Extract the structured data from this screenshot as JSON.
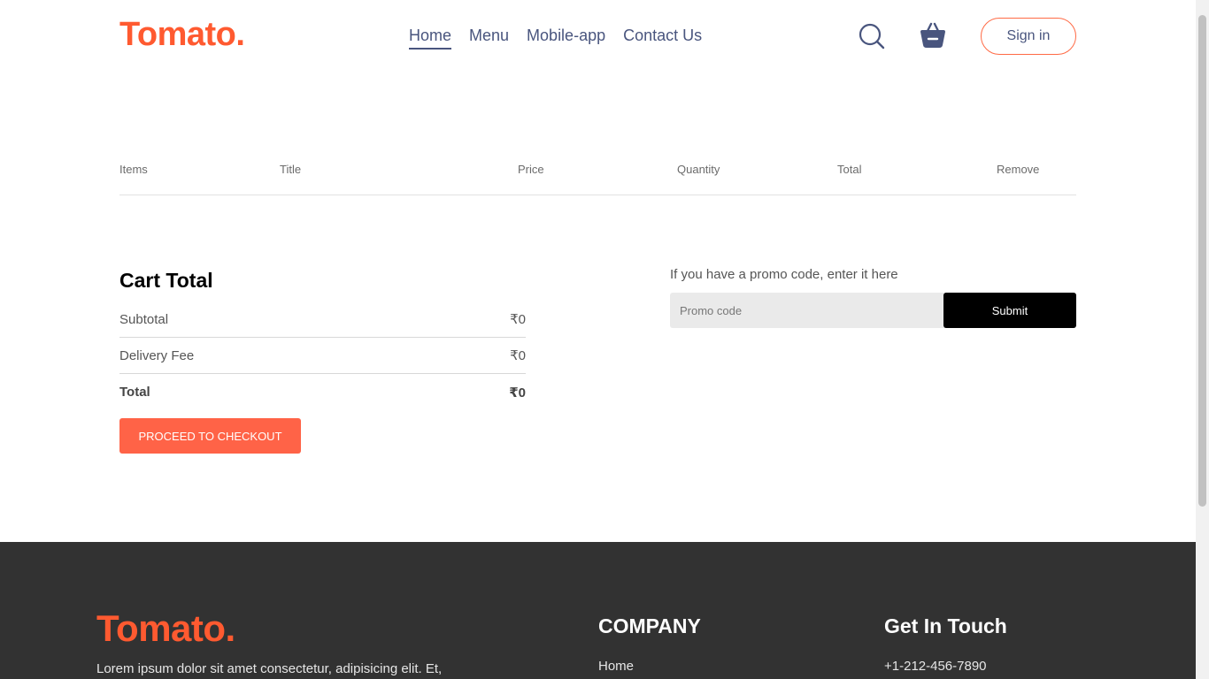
{
  "navbar": {
    "logo": "Tomato.",
    "links": [
      "Home",
      "Menu",
      "Mobile-app",
      "Contact Us"
    ],
    "active": "Home",
    "signin_label": "Sign in",
    "icons": [
      "search-icon",
      "basket-icon"
    ]
  },
  "cart": {
    "columns": [
      "Items",
      "Title",
      "Price",
      "Quantity",
      "Total",
      "Remove"
    ],
    "items": []
  },
  "cart_total": {
    "title": "Cart Total",
    "subtotal_label": "Subtotal",
    "subtotal_value": "₹0",
    "delivery_label": "Delivery Fee",
    "delivery_value": "₹0",
    "total_label": "Total",
    "total_value": "₹0",
    "checkout_label": "PROCEED TO CHECKOUT"
  },
  "promo": {
    "label": "If you have a promo code, enter it here",
    "placeholder": "Promo code",
    "value": "",
    "submit_label": "Submit"
  },
  "footer": {
    "logo": "Tomato.",
    "description": "Lorem ipsum dolor sit amet consectetur, adipisicing elit. Et,",
    "company_heading": "COMPANY",
    "company_links": [
      "Home"
    ],
    "touch_heading": "Get In Touch",
    "phone": "+1-212-456-7890"
  },
  "colors": {
    "brand": "#ff5a30",
    "accent_button": "#ff6347",
    "nav_text": "#49557e",
    "footer_bg": "#323232"
  }
}
